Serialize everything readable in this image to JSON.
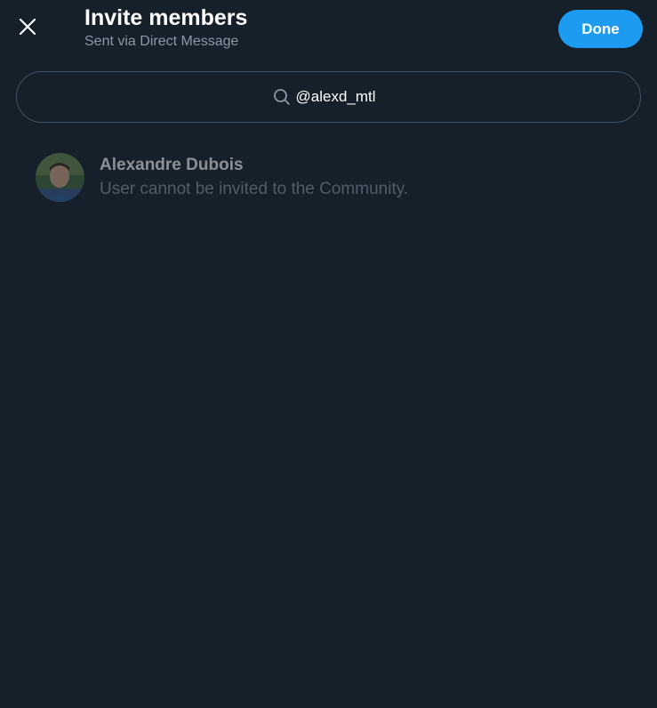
{
  "header": {
    "title": "Invite members",
    "subtitle": "Sent via Direct Message",
    "close_icon": "close-icon",
    "done_label": "Done"
  },
  "search": {
    "value": "@alexd_mtl",
    "icon": "search-icon"
  },
  "results": [
    {
      "name": "Alexandre Dubois",
      "status": "User cannot be invited to the Community.",
      "avatar": "avatar-photo"
    }
  ],
  "colors": {
    "background": "#15202b",
    "accent": "#1d9bf0",
    "secondary_text": "#8b98a5",
    "border": "#425364"
  }
}
